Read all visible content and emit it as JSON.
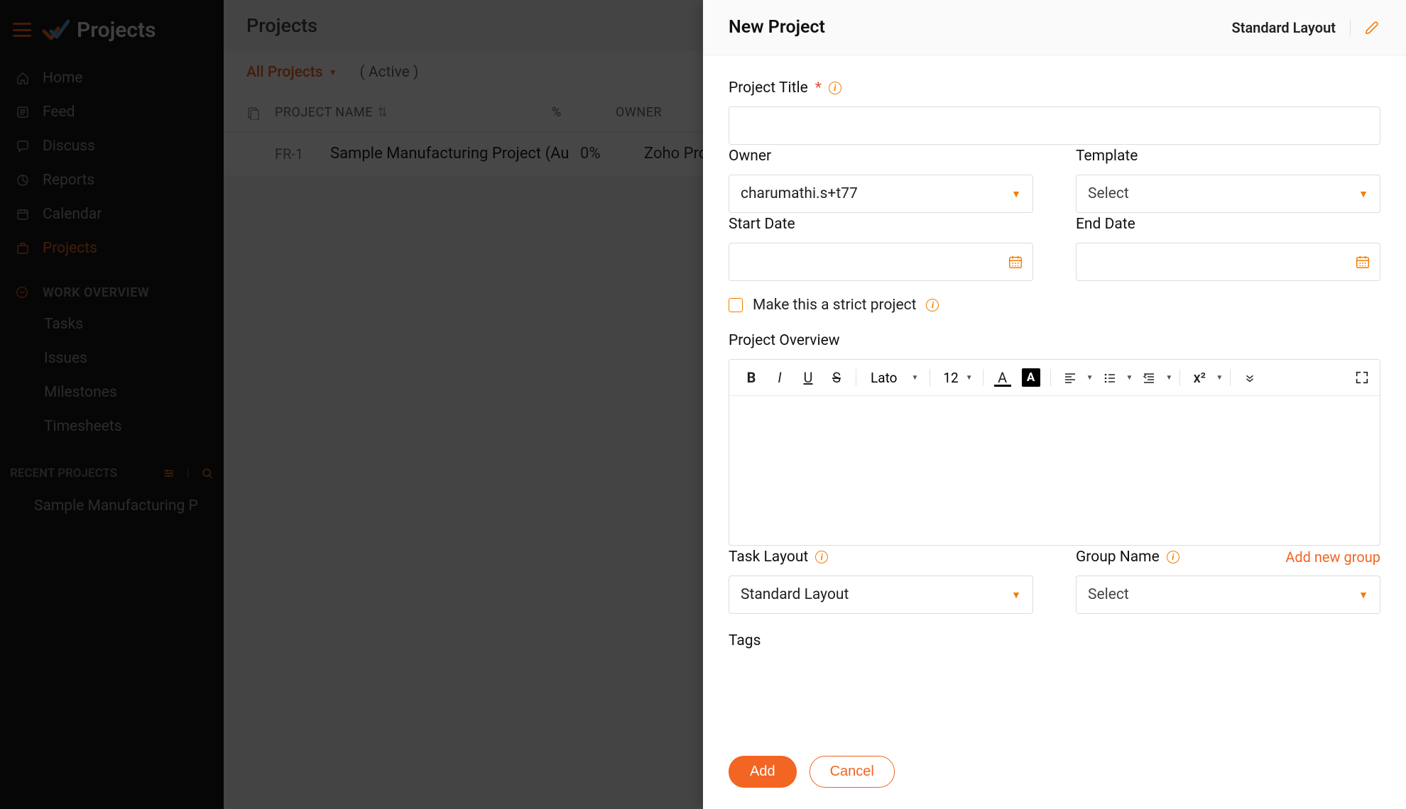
{
  "app": {
    "title": "Projects"
  },
  "sidebar": {
    "items": [
      {
        "label": "Home"
      },
      {
        "label": "Feed"
      },
      {
        "label": "Discuss"
      },
      {
        "label": "Reports"
      },
      {
        "label": "Calendar"
      },
      {
        "label": "Projects"
      }
    ],
    "work_overview_label": "WORK OVERVIEW",
    "work_items": [
      {
        "label": "Tasks"
      },
      {
        "label": "Issues"
      },
      {
        "label": "Milestones"
      },
      {
        "label": "Timesheets"
      }
    ],
    "recent_label": "RECENT PROJECTS",
    "recent_items": [
      {
        "label": "Sample Manufacturing P"
      }
    ]
  },
  "main": {
    "header": "Projects",
    "filter_all": "All Projects",
    "filter_active": "( Active )",
    "columns": {
      "name": "PROJECT NAME",
      "pct": "%",
      "owner": "OWNER"
    },
    "rows": [
      {
        "id": "FR-1",
        "name": "Sample Manufacturing Project (Au",
        "pct": "0%",
        "owner": "Zoho Project"
      }
    ]
  },
  "modal": {
    "title": "New Project",
    "layout_label": "Standard Layout",
    "labels": {
      "project_title": "Project Title",
      "owner": "Owner",
      "template": "Template",
      "start_date": "Start Date",
      "end_date": "End Date",
      "strict": "Make this a strict project",
      "overview": "Project Overview",
      "task_layout": "Task Layout",
      "group_name": "Group Name",
      "add_group": "Add new group",
      "tags": "Tags"
    },
    "values": {
      "owner": "charumathi.s+t77",
      "template": "Select",
      "task_layout": "Standard Layout",
      "group_name": "Select"
    },
    "editor": {
      "font": "Lato",
      "size": "12"
    },
    "buttons": {
      "add": "Add",
      "cancel": "Cancel"
    }
  }
}
